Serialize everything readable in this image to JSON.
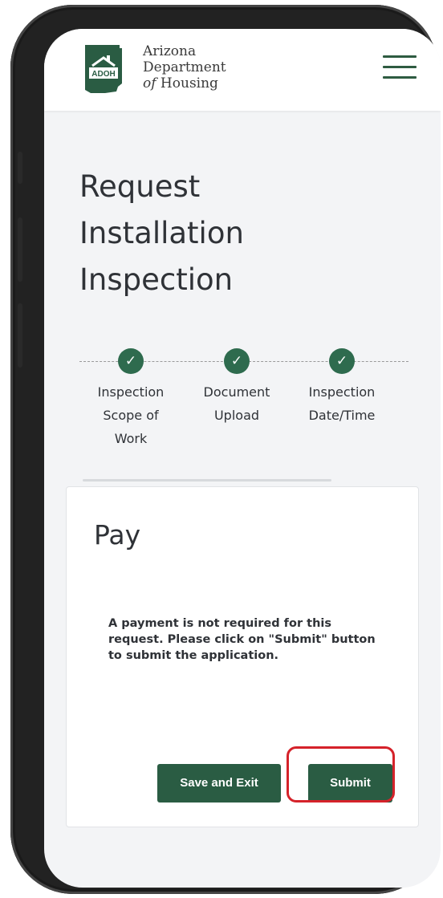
{
  "header": {
    "logo": {
      "badge_text": "ADOH",
      "line1": "Arizona",
      "line2": "Department",
      "line3_italic": "of",
      "line3_rest": " Housing"
    },
    "menu_icon": "hamburger-menu-icon"
  },
  "page": {
    "title_lines": [
      "Request",
      "Installation",
      "Inspection"
    ]
  },
  "stepper": {
    "steps": [
      {
        "label": "Inspection\nScope of\nWork",
        "status": "complete",
        "icon": "check"
      },
      {
        "label": "Document\nUpload",
        "status": "complete",
        "icon": "check"
      },
      {
        "label": "Inspection\nDate/Time",
        "status": "complete",
        "icon": "check"
      }
    ],
    "check_glyph": "✓"
  },
  "card": {
    "title": "Pay",
    "message": "A payment is not required for this request. Please click on \"Submit\" button to submit the application.",
    "buttons": {
      "save_exit": "Save and Exit",
      "submit": "Submit"
    }
  },
  "colors": {
    "brand_green": "#2a5c43",
    "highlight_red": "#d5222a",
    "background": "#f3f4f6"
  }
}
